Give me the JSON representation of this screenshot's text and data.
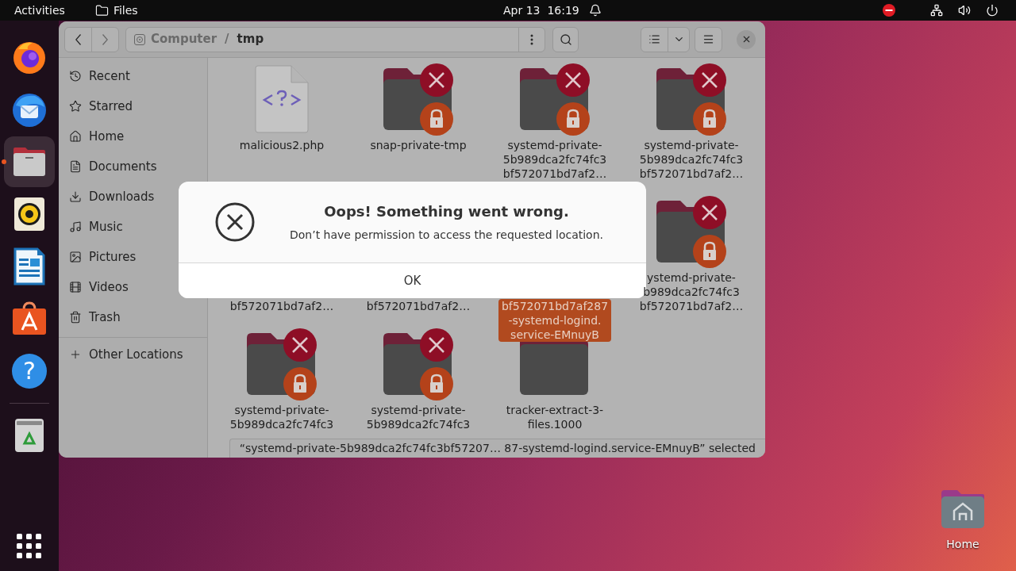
{
  "top_bar": {
    "activities": "Activities",
    "app_menu": "Files",
    "clock": "Apr 13  16:19"
  },
  "dock": {
    "items": [
      {
        "kind": "firefox",
        "active": false
      },
      {
        "kind": "thunderbird",
        "active": false
      },
      {
        "kind": "files",
        "active": true
      },
      {
        "kind": "rhythmbox",
        "active": false
      },
      {
        "kind": "writer",
        "active": false
      },
      {
        "kind": "app_center",
        "active": false
      },
      {
        "kind": "help",
        "active": false,
        "glyph": "?"
      },
      {
        "kind": "trash",
        "active": false
      }
    ]
  },
  "window": {
    "path": [
      {
        "label": "Computer",
        "selected": false
      },
      {
        "label": "tmp",
        "selected": true
      }
    ],
    "path_separator": "/",
    "sidebar": {
      "items": [
        {
          "kind": "recent",
          "label": "Recent"
        },
        {
          "kind": "starred",
          "label": "Starred"
        },
        {
          "kind": "home",
          "label": "Home"
        },
        {
          "kind": "documents",
          "label": "Documents"
        },
        {
          "kind": "downloads",
          "label": "Downloads"
        },
        {
          "kind": "music",
          "label": "Music"
        },
        {
          "kind": "pictures",
          "label": "Pictures"
        },
        {
          "kind": "videos",
          "label": "Videos"
        },
        {
          "kind": "trash",
          "label": "Trash"
        }
      ],
      "other_locations": "Other Locations"
    },
    "files": [
      {
        "kind": "file",
        "selected": false,
        "name_lines": [
          "malicious2.php"
        ]
      },
      {
        "kind": "folder",
        "locked": true,
        "selected": false,
        "name_lines": [
          "snap-private-tmp"
        ]
      },
      {
        "kind": "folder",
        "locked": true,
        "selected": false,
        "name_lines": [
          "systemd-private-",
          "5b989dca2fc74fc3",
          "bf572071bd7af2…"
        ]
      },
      {
        "kind": "folder",
        "locked": true,
        "selected": false,
        "name_lines": [
          "systemd-private-",
          "5b989dca2fc74fc3",
          "bf572071bd7af2…"
        ]
      },
      {
        "kind": "covered",
        "selected": false,
        "name_lines": [
          "bf572071bd7af2…"
        ]
      },
      {
        "kind": "covered",
        "selected": false,
        "name_lines": [
          "bf572071bd7af2…"
        ]
      },
      {
        "kind": "covered",
        "selected": true,
        "name_lines": [
          "bf572071bd7af287",
          "-systemd-logind.",
          "service-EMnuyB"
        ]
      },
      {
        "kind": "folder",
        "locked": true,
        "selected": false,
        "name_lines": [
          "ystemd-private-",
          "b989dca2fc74fc3",
          "bf572071bd7af2…"
        ]
      },
      {
        "kind": "folder",
        "locked": true,
        "selected": false,
        "name_lines": [
          "systemd-private-",
          "5b989dca2fc74fc3"
        ]
      },
      {
        "kind": "folder",
        "locked": true,
        "selected": false,
        "name_lines": [
          "systemd-private-",
          "5b989dca2fc74fc3"
        ]
      },
      {
        "kind": "folder",
        "locked": false,
        "selected": false,
        "name_lines": [
          "tracker-extract-3-",
          "files.1000"
        ]
      }
    ],
    "status_bar": "“systemd-private-5b989dca2fc74fc3bf57207… 87-systemd-logind.service-EMnuyB” selected"
  },
  "dialog": {
    "title": "Oops! Something went wrong.",
    "message": "Don’t have permission to access the requested location.",
    "button": "OK"
  },
  "desktop_icons": [
    {
      "label": "Home"
    }
  ]
}
